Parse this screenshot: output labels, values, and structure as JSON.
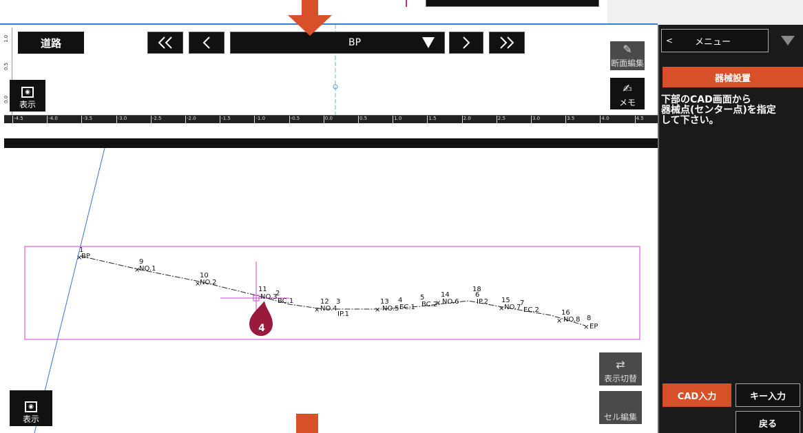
{
  "toolbar": {
    "road_label": "道路",
    "nav_first": "《",
    "nav_prev": "〈",
    "station_value": "BP",
    "nav_next": "〉",
    "nav_last": "》",
    "section_edit_label": "断面編集",
    "memo_label": "メモ",
    "display_label": "表示"
  },
  "ruler": {
    "vertical_labels": [
      "1.0",
      "0.5",
      "0.0"
    ],
    "horizontal_labels": [
      "-4.5",
      "-4.0",
      "-3.5",
      "-3.0",
      "-2.5",
      "-2.0",
      "-1.5",
      "-1.0",
      "-0.5",
      "0.0",
      "0.5",
      "1.0",
      "1.5",
      "2.0",
      "2.5",
      "3.0",
      "3.5",
      "4.0",
      "4.5"
    ]
  },
  "right_panel": {
    "menu_label": "メニュー",
    "menu_back_icon": "chevron-left-icon",
    "setup_button_label": "器械設置",
    "instruction_lines": [
      "下部のCAD画面から",
      "器械点(センター点)を指定",
      "して下さい。"
    ],
    "cad_input_label": "CAD入力",
    "key_input_label": "キー入力",
    "back_label": "戻る"
  },
  "cad": {
    "display_toggle_label": "表示切替",
    "cell_edit_label": "セル編集",
    "display_label": "表示",
    "step_badge": "4",
    "points": [
      {
        "num": "1",
        "name": "BP"
      },
      {
        "num": "9",
        "name": "NO.1"
      },
      {
        "num": "10",
        "name": "NO.2"
      },
      {
        "num": "11",
        "name": "NO.3"
      },
      {
        "num": "2",
        "name": "BC.1"
      },
      {
        "num": "12",
        "name": "NO.4"
      },
      {
        "num": "3",
        "name": "IP.1"
      },
      {
        "num": "13",
        "name": "NO.5"
      },
      {
        "num": "4",
        "name": "EC.1"
      },
      {
        "num": "5",
        "name": "BC.2"
      },
      {
        "num": "14",
        "name": "NO.6"
      },
      {
        "num": "6",
        "name": "IP.2"
      },
      {
        "num": "18",
        "name": ""
      },
      {
        "num": "15",
        "name": "NO.7"
      },
      {
        "num": "7",
        "name": "EC.2"
      },
      {
        "num": "16",
        "name": "NO.8"
      },
      {
        "num": "8",
        "name": "EP"
      }
    ]
  },
  "colors": {
    "accent": "#d8502a",
    "panel_dark": "#1a1a1a",
    "bbox_magenta": "#d040d0",
    "ruler_blue": "#3a7bd5"
  }
}
